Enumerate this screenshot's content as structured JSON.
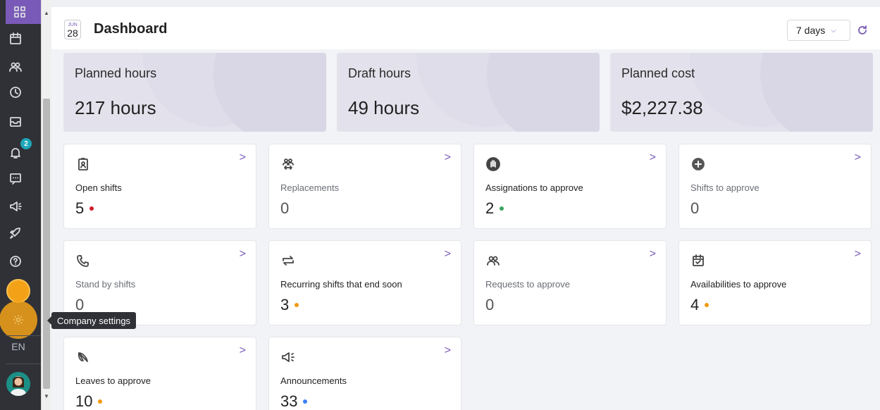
{
  "header": {
    "date_month": "JUN",
    "date_day": "28",
    "title": "Dashboard",
    "range": "7 days"
  },
  "stats": [
    {
      "label": "Planned hours",
      "value": "217 hours"
    },
    {
      "label": "Draft hours",
      "value": "49 hours"
    },
    {
      "label": "Planned cost",
      "value": "$2,227.38"
    }
  ],
  "tiles": [
    {
      "label": "Open shifts",
      "count": "5",
      "dot": "#d21b2a",
      "icon": "badge-icon"
    },
    {
      "label": "Replacements",
      "count": "0",
      "dot": null,
      "icon": "swap-people-icon"
    },
    {
      "label": "Assignations to approve",
      "count": "2",
      "dot": "#3aa55c",
      "icon": "hand-icon"
    },
    {
      "label": "Shifts to approve",
      "count": "0",
      "dot": null,
      "icon": "plus-circle-icon"
    },
    {
      "label": "Stand by shifts",
      "count": "0",
      "dot": null,
      "icon": "phone-icon"
    },
    {
      "label": "Recurring shifts that end soon",
      "count": "3",
      "dot": "#f39a11",
      "icon": "repeat-icon"
    },
    {
      "label": "Requests to approve",
      "count": "0",
      "dot": null,
      "icon": "people-icon"
    },
    {
      "label": "Availabilities to approve",
      "count": "4",
      "dot": "#f39a11",
      "icon": "calendar-check-icon"
    },
    {
      "label": "Leaves to approve",
      "count": "10",
      "dot": "#f39a11",
      "icon": "umbrella-icon"
    },
    {
      "label": "Announcements",
      "count": "33",
      "dot": "#3b82f6",
      "icon": "megaphone-icon"
    }
  ],
  "sidebar": {
    "lang": "EN",
    "notification_count": "2",
    "tooltip": "Company settings"
  },
  "colors": {
    "accent": "#7a5ab8",
    "sidebar_bg": "#2f3136"
  }
}
